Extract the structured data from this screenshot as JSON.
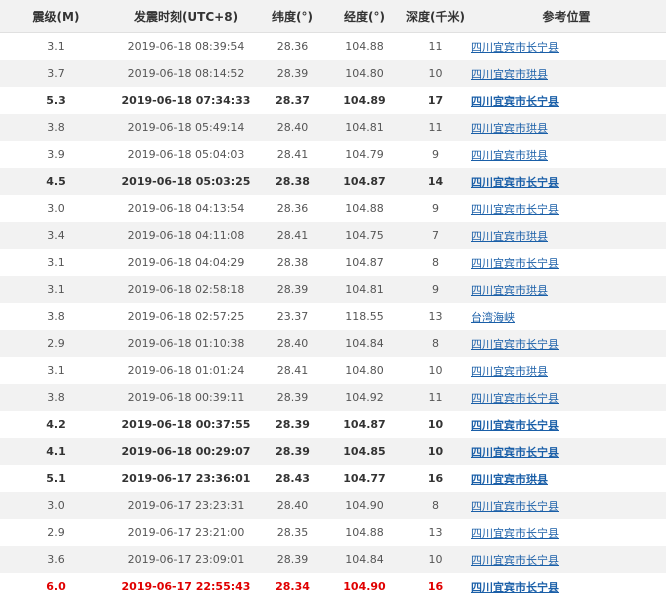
{
  "header": {
    "magnitude": "震级(M)",
    "time": "发震时刻(UTC+8)",
    "latitude": "纬度(°)",
    "longitude": "经度(°)",
    "depth": "深度(千米)",
    "location": "参考位置"
  },
  "rows": [
    {
      "mag": "3.1",
      "time": "2019-06-18 08:39:54",
      "lat": "28.36",
      "lon": "104.88",
      "depth": "11",
      "loc": "四川宜宾市长宁县",
      "style": "normal"
    },
    {
      "mag": "3.7",
      "time": "2019-06-18 08:14:52",
      "lat": "28.39",
      "lon": "104.80",
      "depth": "10",
      "loc": "四川宜宾市珙县",
      "style": "normal"
    },
    {
      "mag": "5.3",
      "time": "2019-06-18 07:34:33",
      "lat": "28.37",
      "lon": "104.89",
      "depth": "17",
      "loc": "四川宜宾市长宁县",
      "style": "strong"
    },
    {
      "mag": "3.8",
      "time": "2019-06-18 05:49:14",
      "lat": "28.40",
      "lon": "104.81",
      "depth": "11",
      "loc": "四川宜宾市珙县",
      "style": "normal"
    },
    {
      "mag": "3.9",
      "time": "2019-06-18 05:04:03",
      "lat": "28.41",
      "lon": "104.79",
      "depth": "9",
      "loc": "四川宜宾市珙县",
      "style": "normal"
    },
    {
      "mag": "4.5",
      "time": "2019-06-18 05:03:25",
      "lat": "28.38",
      "lon": "104.87",
      "depth": "14",
      "loc": "四川宜宾市长宁县",
      "style": "strong"
    },
    {
      "mag": "3.0",
      "time": "2019-06-18 04:13:54",
      "lat": "28.36",
      "lon": "104.88",
      "depth": "9",
      "loc": "四川宜宾市长宁县",
      "style": "normal"
    },
    {
      "mag": "3.4",
      "time": "2019-06-18 04:11:08",
      "lat": "28.41",
      "lon": "104.75",
      "depth": "7",
      "loc": "四川宜宾市珙县",
      "style": "normal"
    },
    {
      "mag": "3.1",
      "time": "2019-06-18 04:04:29",
      "lat": "28.38",
      "lon": "104.87",
      "depth": "8",
      "loc": "四川宜宾市长宁县",
      "style": "normal"
    },
    {
      "mag": "3.1",
      "time": "2019-06-18 02:58:18",
      "lat": "28.39",
      "lon": "104.81",
      "depth": "9",
      "loc": "四川宜宾市珙县",
      "style": "normal"
    },
    {
      "mag": "3.8",
      "time": "2019-06-18 02:57:25",
      "lat": "23.37",
      "lon": "118.55",
      "depth": "13",
      "loc": "台湾海峡",
      "style": "normal"
    },
    {
      "mag": "2.9",
      "time": "2019-06-18 01:10:38",
      "lat": "28.40",
      "lon": "104.84",
      "depth": "8",
      "loc": "四川宜宾市长宁县",
      "style": "normal"
    },
    {
      "mag": "3.1",
      "time": "2019-06-18 01:01:24",
      "lat": "28.41",
      "lon": "104.80",
      "depth": "10",
      "loc": "四川宜宾市珙县",
      "style": "normal"
    },
    {
      "mag": "3.8",
      "time": "2019-06-18 00:39:11",
      "lat": "28.39",
      "lon": "104.92",
      "depth": "11",
      "loc": "四川宜宾市长宁县",
      "style": "normal"
    },
    {
      "mag": "4.2",
      "time": "2019-06-18 00:37:55",
      "lat": "28.39",
      "lon": "104.87",
      "depth": "10",
      "loc": "四川宜宾市长宁县",
      "style": "strong"
    },
    {
      "mag": "4.1",
      "time": "2019-06-18 00:29:07",
      "lat": "28.39",
      "lon": "104.85",
      "depth": "10",
      "loc": "四川宜宾市长宁县",
      "style": "strong"
    },
    {
      "mag": "5.1",
      "time": "2019-06-17 23:36:01",
      "lat": "28.43",
      "lon": "104.77",
      "depth": "16",
      "loc": "四川宜宾市珙县",
      "style": "strong"
    },
    {
      "mag": "3.0",
      "time": "2019-06-17 23:23:31",
      "lat": "28.40",
      "lon": "104.90",
      "depth": "8",
      "loc": "四川宜宾市长宁县",
      "style": "normal"
    },
    {
      "mag": "2.9",
      "time": "2019-06-17 23:21:00",
      "lat": "28.35",
      "lon": "104.88",
      "depth": "13",
      "loc": "四川宜宾市长宁县",
      "style": "normal"
    },
    {
      "mag": "3.6",
      "time": "2019-06-17 23:09:01",
      "lat": "28.39",
      "lon": "104.84",
      "depth": "10",
      "loc": "四川宜宾市长宁县",
      "style": "normal"
    },
    {
      "mag": "6.0",
      "time": "2019-06-17 22:55:43",
      "lat": "28.34",
      "lon": "104.90",
      "depth": "16",
      "loc": "四川宜宾市长宁县",
      "style": "major"
    }
  ]
}
